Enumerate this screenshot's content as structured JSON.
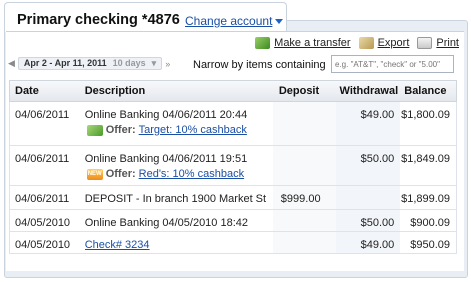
{
  "account": {
    "title": "Primary checking *4876",
    "change_label": "Change account"
  },
  "actions": {
    "transfer": "Make a transfer",
    "export": "Export",
    "print": "Print"
  },
  "filter": {
    "date_range": "Apr 2 - Apr 11, 2011",
    "days": "10 days",
    "narrow_label": "Narrow by items containing",
    "search_placeholder": "e.g. \"AT&T\", \"check\" or \"5.00\""
  },
  "table": {
    "headers": {
      "date": "Date",
      "description": "Description",
      "deposit": "Deposit",
      "withdrawal": "Withdrawal",
      "balance": "Balance"
    },
    "rows": [
      {
        "date": "04/06/2011",
        "description": "Online Banking 04/06/2011  20:44",
        "offer_label": "Offer:",
        "offer_text": "Target: 10% cashback",
        "offer_icon": "green-tag-icon",
        "deposit": "",
        "withdrawal": "$49.00",
        "balance": "$1,800.09"
      },
      {
        "date": "04/06/2011",
        "description": "Online Banking  04/06/2011 19:51",
        "offer_label": "Offer:",
        "offer_text": "Red's: 10% cashback",
        "offer_icon": "new-badge-icon",
        "deposit": "",
        "withdrawal": "$50.00",
        "balance": "$1,849.09"
      },
      {
        "date": "04/06/2011",
        "description": "DEPOSIT - In branch  1900 Market St",
        "deposit": "$999.00",
        "withdrawal": "",
        "balance": "$1,899.09"
      },
      {
        "date": "04/05/2010",
        "description": "Online Banking 04/05/2010 18:42",
        "deposit": "",
        "withdrawal": "$50.00",
        "balance": "$900.09"
      },
      {
        "date": "04/05/2010",
        "description": "Check# 3234",
        "is_link": true,
        "deposit": "",
        "withdrawal": "$49.00",
        "balance": "$950.09"
      }
    ]
  }
}
